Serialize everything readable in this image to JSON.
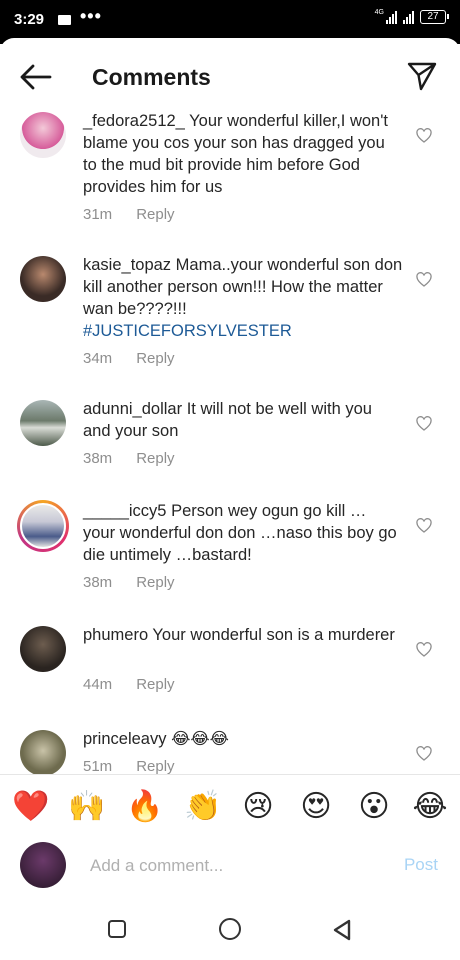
{
  "status": {
    "time": "3:29",
    "battery": "27"
  },
  "header": {
    "title": "Comments"
  },
  "comments": [
    {
      "username": "_fedora2512_",
      "text": "Your wonderful killer,I won't blame you cos your son has dragged you to the mud bit provide him before God provides him for us",
      "time": "31m",
      "reply": "Reply"
    },
    {
      "username": "kasie_topaz",
      "text": "Mama..your wonderful son don kill another person own!!! How the matter wan be????!!!",
      "hashtag": "#JUSTICEFORSYLVESTER",
      "time": "34m",
      "reply": "Reply"
    },
    {
      "username": "adunni_dollar",
      "text": "It will not be well with you and your son",
      "time": "38m",
      "reply": "Reply"
    },
    {
      "username": "_____iccy5",
      "text": "Person wey ogun go kill … your wonderful don don …naso this boy go die untimely …bastard!",
      "time": "38m",
      "reply": "Reply"
    },
    {
      "username": "phumero",
      "text": "Your wonderful son is a murderer",
      "time": "44m",
      "reply": "Reply"
    },
    {
      "username": "princeleavy",
      "text": "😂😂😂",
      "time": "51m",
      "reply": "Reply"
    }
  ],
  "reactions": [
    "❤️",
    "🙌",
    "🔥",
    "👏",
    "😢",
    "😍",
    "😮",
    "😂"
  ],
  "composer": {
    "placeholder": "Add a comment...",
    "post_label": "Post"
  }
}
